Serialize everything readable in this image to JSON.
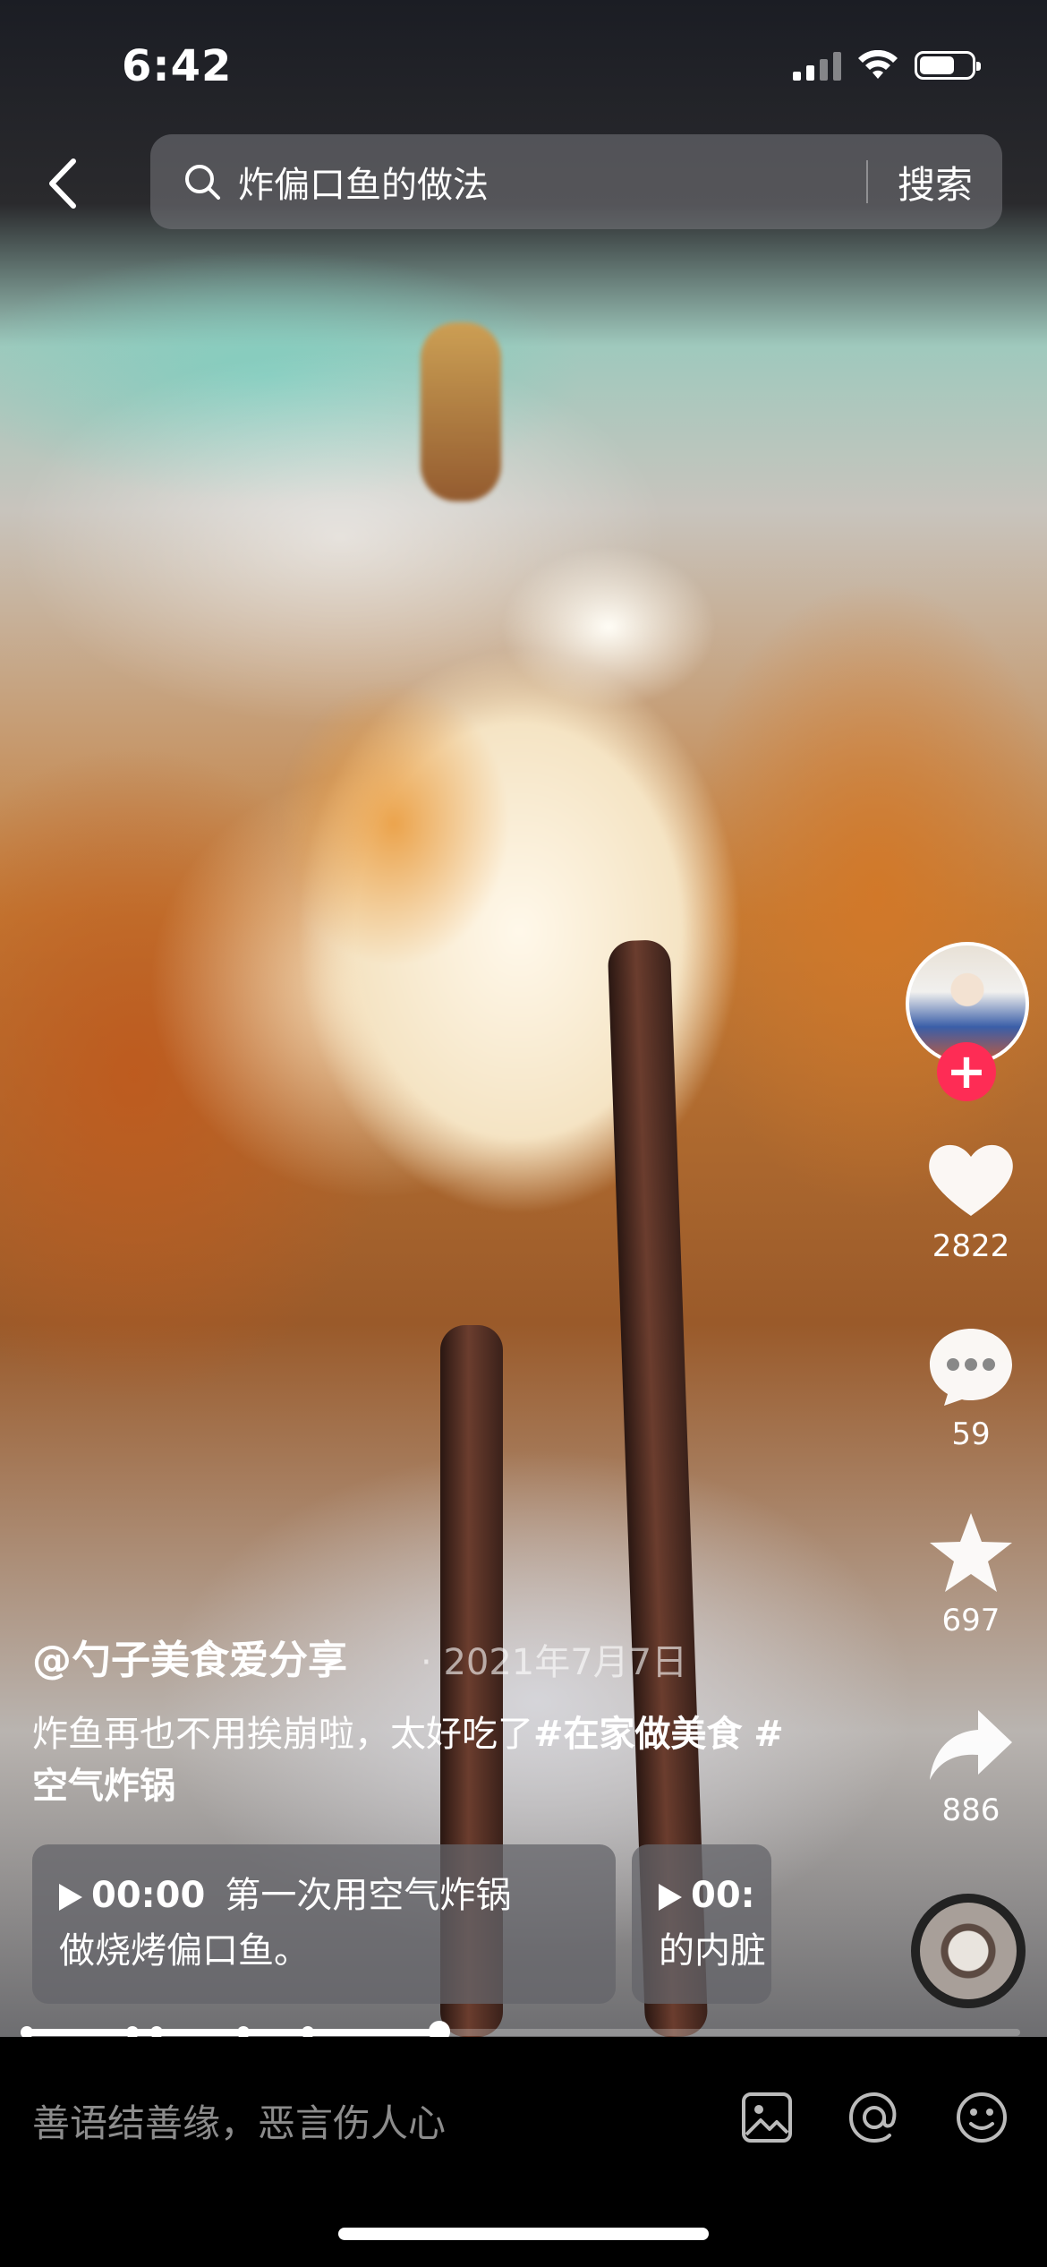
{
  "status_bar": {
    "time": "6:42"
  },
  "search": {
    "query": "炸偏口鱼的做法",
    "button": "搜索"
  },
  "actions": {
    "likes": "2822",
    "comments": "59",
    "favorites": "697",
    "shares": "886"
  },
  "post": {
    "author": "@勺子美食爱分享",
    "date_sep": "·",
    "date": "2021年7月7日",
    "caption_text": "炸鱼再也不用挨崩啦，太好吃了",
    "hashtag_1": "#在家做美食",
    "hashtag_2": "#空气炸锅"
  },
  "chapters": [
    {
      "time": "00:00",
      "line1": "第一次用空气炸锅",
      "line2": "做烧烤偏口鱼。"
    },
    {
      "time": "00:",
      "line2": "的内脏"
    }
  ],
  "progress": {
    "fraction": 0.415,
    "markers": [
      0,
      0.106,
      0.131,
      0.218,
      0.283
    ]
  },
  "comment_bar": {
    "placeholder": "善语结善缘，恶言伤人心"
  },
  "colors": {
    "follow_accent": "#fe2c55",
    "placeholder_gray": "#8c8c8c"
  }
}
